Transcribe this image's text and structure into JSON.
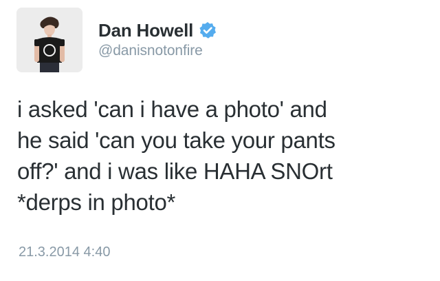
{
  "user": {
    "display_name": "Dan Howell",
    "handle": "@danisnotonfire",
    "verified": true,
    "avatar_icon": "profile-photo",
    "verified_icon": "verified-badge-icon"
  },
  "tweet": {
    "text": "i asked 'can i have a photo' and\nhe said 'can you take your pants\noff?' and i was like HAHA SNOrt\n*derps in photo*",
    "timestamp": "21.3.2014 4:40"
  },
  "colors": {
    "text": "#292f33",
    "secondary": "#8899a6",
    "verified": "#55acee",
    "background": "#ffffff"
  }
}
